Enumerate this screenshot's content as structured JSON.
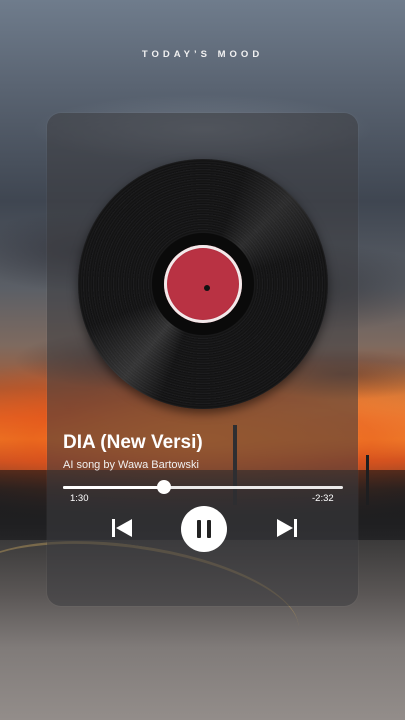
{
  "header": {
    "title": "TODAY’S MOOD"
  },
  "player": {
    "song_title": "DIA (New Versi)",
    "artist": "AI song by Wawa Bartowski",
    "elapsed": "1:30",
    "remaining": "-2:32",
    "progress_fraction": 0.36
  },
  "controls": {
    "previous_icon": "skip-previous-icon",
    "pause_icon": "pause-icon",
    "next_icon": "skip-next-icon"
  },
  "colors": {
    "record_label": "#b93243",
    "accent": "#ffffff"
  }
}
